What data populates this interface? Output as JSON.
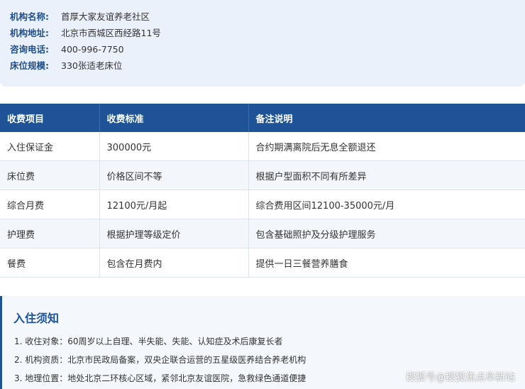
{
  "info": {
    "rows": [
      {
        "key": "机构名称:",
        "value": "首厚大家友谊养老社区"
      },
      {
        "key": "机构地址:",
        "value": "北京市西城区西经路11号"
      },
      {
        "key": "咨询电话:",
        "value": "400-996-7750"
      },
      {
        "key": "床位规模:",
        "value": "330张适老床位"
      }
    ]
  },
  "table": {
    "headers": [
      "收费项目",
      "收费标准",
      "备注说明"
    ],
    "rows": [
      [
        "入住保证金",
        "300000元",
        "合约期满离院后无息全额退还"
      ],
      [
        "床位费",
        "价格区间不等",
        "根据户型面积不同有所差异"
      ],
      [
        "综合月费",
        "12100元/月起",
        "综合费用区间12100-35000元/月"
      ],
      [
        "护理费",
        "根据护理等级定价",
        "包含基础照护及分级护理服务"
      ],
      [
        "餐费",
        "包含在月费内",
        "提供一日三餐营养膳食"
      ]
    ]
  },
  "notice": {
    "title": "入住须知",
    "items": [
      "1. 收住对象：60周岁以上自理、半失能、失能、认知症及术后康复长者",
      "2. 机构资质：北京市民政局备案，双央企联合运营的五星级医养结合养老机构",
      "3. 地理位置：地处北京二环核心区域，紧邻北京友谊医院，急救绿色通道便捷"
    ]
  },
  "watermark": "搜狐号@搜狐焦点阜新站",
  "colors": {
    "accent": "#1e5497",
    "info_bg": "#eaf1fa",
    "row_alt": "#f3f6fa"
  }
}
